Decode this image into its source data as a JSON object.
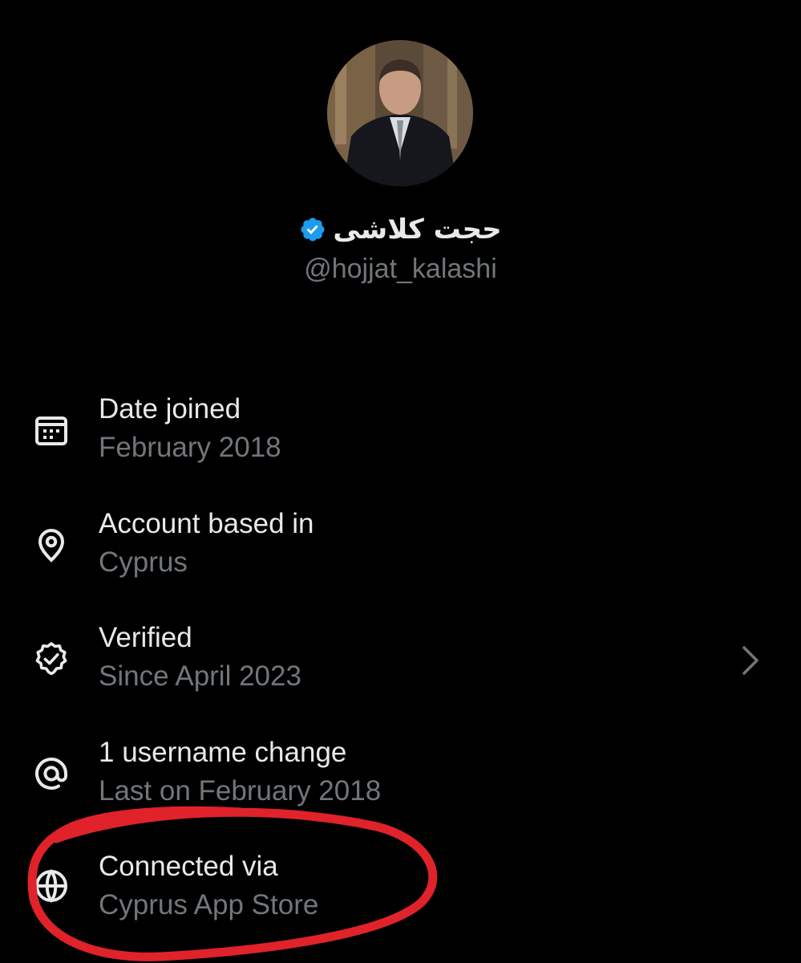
{
  "profile": {
    "display_name": "حجت کلاشی",
    "handle": "@hojjat_kalashi",
    "verified_color": "#1d9bf0"
  },
  "info_rows": [
    {
      "icon": "calendar-icon",
      "title": "Date joined",
      "subtitle": "February 2018"
    },
    {
      "icon": "location-pin-icon",
      "title": "Account based in",
      "subtitle": "Cyprus"
    },
    {
      "icon": "verified-badge-icon",
      "title": "Verified",
      "subtitle": "Since April 2023",
      "has_chevron": true
    },
    {
      "icon": "at-sign-icon",
      "title": "1 username change",
      "subtitle": "Last on February 2018"
    },
    {
      "icon": "globe-icon",
      "title": "Connected via",
      "subtitle": "Cyprus App Store"
    }
  ],
  "colors": {
    "background": "#000000",
    "primary_text": "#e7e9ea",
    "secondary_text": "#71767b",
    "annotation_circle": "#e0222a"
  }
}
